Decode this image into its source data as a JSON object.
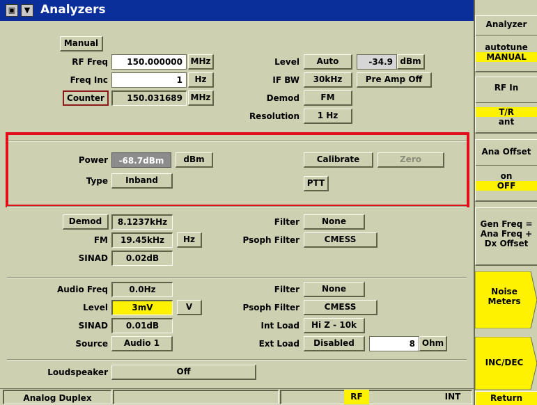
{
  "window": {
    "title": "Analyzers"
  },
  "rf": {
    "manual_label": "Manual",
    "rf_freq_label": "RF Freq",
    "rf_freq_value": "150.000000",
    "rf_freq_unit": "MHz",
    "freq_inc_label": "Freq Inc",
    "freq_inc_value": "1",
    "freq_inc_unit": "Hz",
    "counter_label": "Counter",
    "counter_value": "150.031689",
    "counter_unit": "MHz",
    "level_label": "Level",
    "level_mode": "Auto",
    "level_value": "-34.9",
    "level_unit": "dBm",
    "ifbw_label": "IF BW",
    "ifbw_value": "30kHz",
    "preamp_label": "Pre Amp Off",
    "demod_label": "Demod",
    "demod_value": "FM",
    "resolution_label": "Resolution",
    "resolution_value": "1 Hz"
  },
  "power": {
    "power_label": "Power",
    "power_value": "-68.7dBm",
    "power_unit": "dBm",
    "type_label": "Type",
    "type_value": "Inband",
    "calibrate_label": "Calibrate",
    "zero_label": "Zero",
    "ptt_label": "PTT"
  },
  "demod": {
    "demod_label": "Demod",
    "demod_value": "8.1237kHz",
    "fm_label": "FM",
    "fm_value": "19.45kHz",
    "fm_unit": "Hz",
    "sinad_label": "SINAD",
    "sinad_value": "0.02dB",
    "filter_label": "Filter",
    "filter_value": "None",
    "psoph_label": "Psoph Filter",
    "psoph_value": "CMESS"
  },
  "audio": {
    "freq_label": "Audio Freq",
    "freq_value": "0.0Hz",
    "level_label": "Level",
    "level_value": "3mV",
    "level_unit": "V",
    "sinad_label": "SINAD",
    "sinad_value": "0.01dB",
    "source_label": "Source",
    "source_value": "Audio 1",
    "filter_label": "Filter",
    "filter_value": "None",
    "psoph_label": "Psoph Filter",
    "psoph_value": "CMESS",
    "intload_label": "Int Load",
    "intload_value": "Hi Z - 10k",
    "extload_label": "Ext Load",
    "extload_value": "Disabled",
    "extload_num": "8",
    "extload_unit": "Ohm"
  },
  "loudspeaker": {
    "label": "Loudspeaker",
    "value": "Off"
  },
  "status": {
    "mode": "Analog Duplex",
    "rf": "RF",
    "int": "INT"
  },
  "softkeys": {
    "analyzer_title": "Analyzer",
    "analyzer_opt1": "autotune",
    "analyzer_opt2": "MANUAL",
    "rfin_title": "RF In",
    "rfin_opt1": "T/R",
    "rfin_opt2": "ant",
    "anaoffset_title": "Ana Offset",
    "anaoffset_opt1": "on",
    "anaoffset_opt2": "OFF",
    "genfreq_line1": "Gen Freq =",
    "genfreq_line2": "Ana Freq +",
    "genfreq_line3": "Dx Offset",
    "noise_line1": "Noise",
    "noise_line2": "Meters",
    "incdec": "INC/DEC",
    "return": "Return"
  },
  "colors": {
    "title_bar": "#0a2f9a",
    "panel": "#cdd1b1",
    "highlight_yellow": "#fff200",
    "selection_red": "#e0101a",
    "counter_border": "#8b1a1a"
  }
}
